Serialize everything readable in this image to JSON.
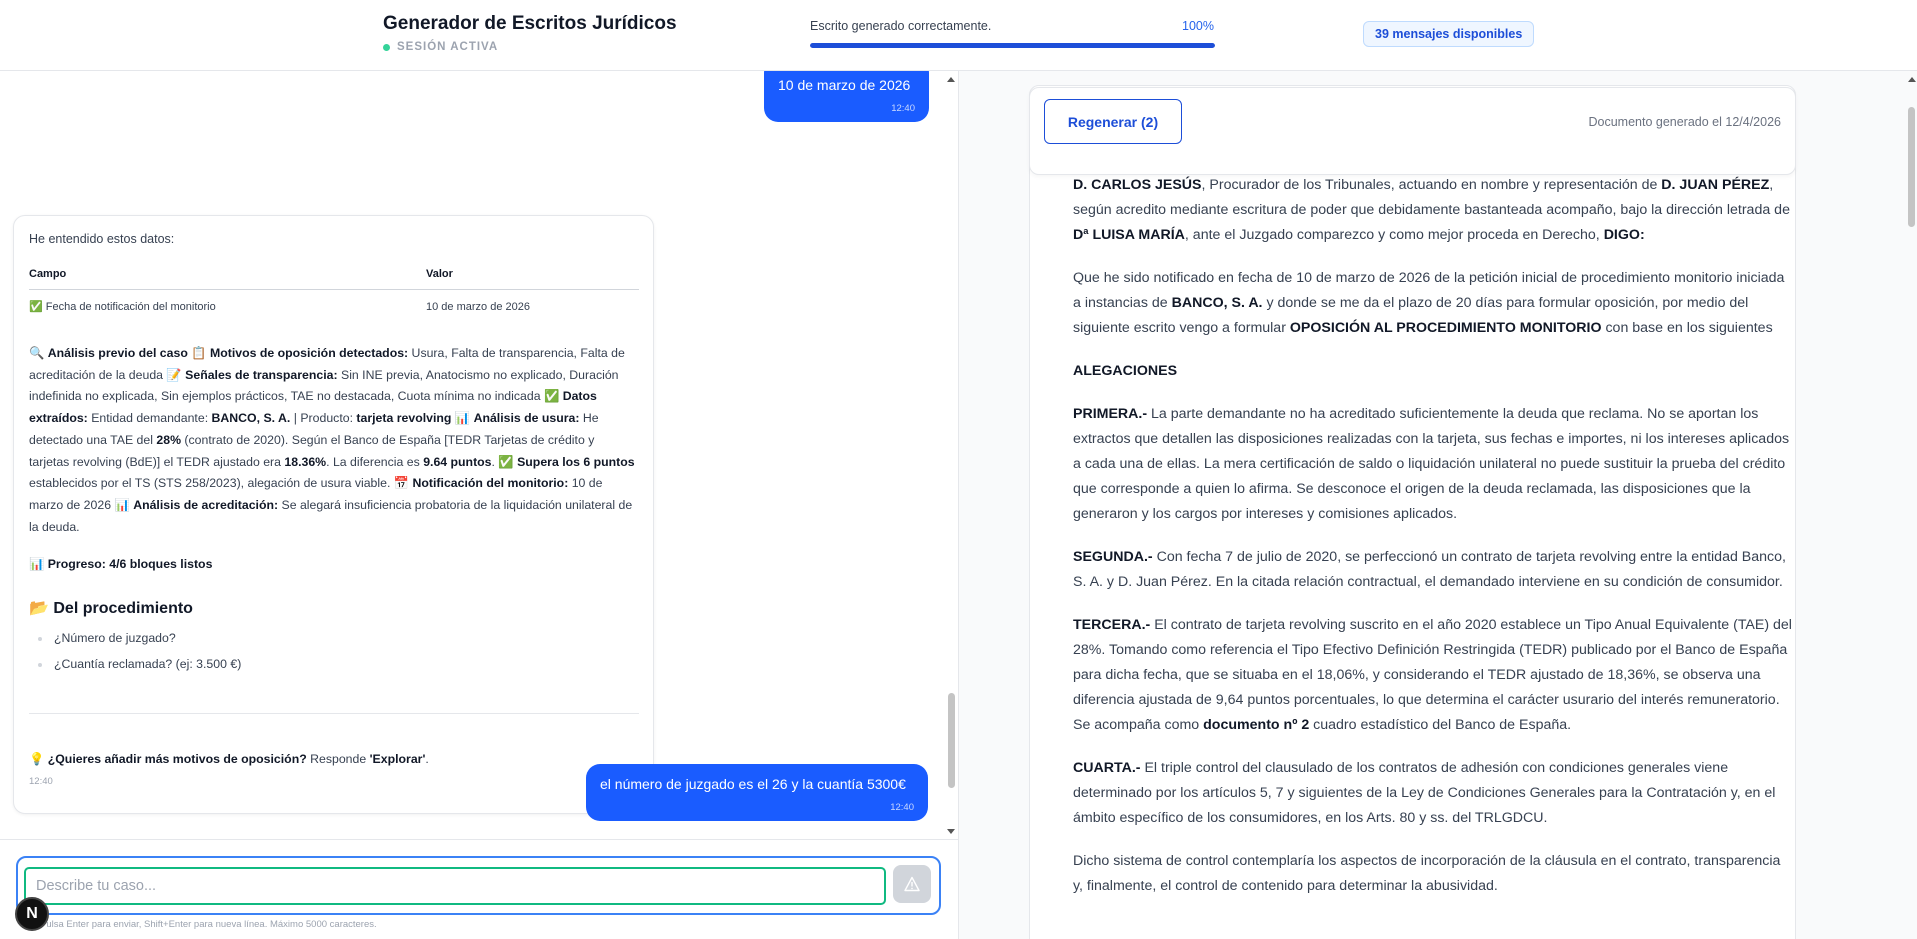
{
  "header": {
    "title": "Generador de Escritos Jurídicos",
    "session_status": "SESIÓN ACTIVA",
    "progress_label": "Escrito generado correctamente.",
    "progress_percent": "100%",
    "progress_value": 1.0,
    "messages_badge": "39 mensajes disponibles"
  },
  "chat": {
    "user_msg_1": {
      "text": "10 de marzo de 2026",
      "time": "12:40"
    },
    "bot": {
      "intro": "He entendido estos datos:",
      "table": {
        "headers": [
          "Campo",
          "Valor"
        ],
        "rows": [
          [
            "✅ Fecha de notificación del monitorio",
            "10 de marzo de 2026"
          ]
        ]
      },
      "analysis": {
        "s1": "🔍 ",
        "b1": "Análisis previo del caso",
        "s2": " 📋 ",
        "b2": "Motivos de oposición detectados:",
        "s3": " Usura, Falta de transparencia, Falta de acreditación de la deuda 📝 ",
        "b3": "Señales de transparencia:",
        "s4": " Sin INE previa, Anatocismo no explicado, Duración indefinida no explicada, Sin ejemplos prácticos, TAE no destacada, Cuota mínima no indicada ✅ ",
        "b4": "Datos extraídos:",
        "s5": " Entidad demandante: ",
        "b5": "BANCO, S. A.",
        "s6": " | Producto: ",
        "b6": "tarjeta revolving",
        "s7": " 📊 ",
        "b7": "Análisis de usura:",
        "s8": " He detectado una TAE del ",
        "b8": "28%",
        "s9": " (contrato de 2020). Según el Banco de España [TEDR Tarjetas de crédito y tarjetas revolving (BdE)] el TEDR ajustado era ",
        "b9": "18.36%",
        "s10": ". La diferencia es ",
        "b10": "9.64 puntos",
        "s11": ". ✅ ",
        "b11": "Supera los 6 puntos",
        "s12": " establecidos por el TS (STS 258/2023), alegación de usura viable. 📅 ",
        "b12": "Notificación del monitorio:",
        "s13": " 10 de marzo de 2026 📊 ",
        "b13": "Análisis de acreditación:",
        "s14": " Se alegará insuficiencia probatoria de la liquidación unilateral de la deuda."
      },
      "progress": "📊 Progreso: 4/6 bloques listos",
      "section_title": "📂 Del procedimiento",
      "questions": [
        "¿Número de juzgado?",
        "¿Cuantía reclamada? (ej: 3.500 €)"
      ],
      "cta_icon": "💡 ",
      "cta_bold": "¿Quieres añadir más motivos de oposición?",
      "cta_text": " Responde ",
      "cta_quote": "'Explorar'",
      "cta_end": ".",
      "time": "12:40"
    },
    "user_msg_2": {
      "text": "el número de juzgado es el 26 y la cuantía 5300€",
      "time": "12:40"
    }
  },
  "input": {
    "placeholder": "Describe tu caso...",
    "hint": "Pulsa Enter para enviar, Shift+Enter para nueva línea. Máximo 5000 caracteres.",
    "send_icon": "warning-triangle-icon",
    "avatar_letter": "N"
  },
  "document": {
    "regenerate_label": "Regenerar (2)",
    "generated_date": "Documento generado el 12/4/2026",
    "p1": {
      "b1": "D. CARLOS JESÚS",
      "t1": ", Procurador de los Tribunales, actuando en nombre y representación de ",
      "b2": "D. JUAN PÉREZ",
      "t2": ", según acredito mediante escritura de poder que debidamente bastanteada acompaño, bajo la dirección letrada de ",
      "b3": "Dª LUISA MARÍA",
      "t3": ", ante el Juzgado comparezco y como mejor proceda en Derecho, ",
      "b4": "DIGO:"
    },
    "p2": {
      "t1": "Que he sido notificado en fecha de 10 de marzo de 2026 de la petición inicial de procedimiento monitorio iniciada a instancias de ",
      "b1": "BANCO, S. A.",
      "t2": " y donde se me da el plazo de 20 días para formular oposición, por medio del siguiente escrito vengo a formular ",
      "b2": "OPOSICIÓN AL PROCEDIMIENTO MONITORIO",
      "t3": " con base en los siguientes"
    },
    "alegaciones": "ALEGACIONES",
    "primera": {
      "h": "PRIMERA.-",
      "t": " La parte demandante no ha acreditado suficientemente la deuda que reclama. No se aportan los extractos que detallen las disposiciones realizadas con la tarjeta, sus fechas e importes, ni los intereses aplicados a cada una de ellas. La mera certificación de saldo o liquidación unilateral no puede sustituir la prueba del crédito que corresponde a quien lo afirma. Se desconoce el origen de la deuda reclamada, las disposiciones que la generaron y los cargos por intereses y comisiones aplicados."
    },
    "segunda": {
      "h": "SEGUNDA.-",
      "t": " Con fecha 7 de julio de 2020, se perfeccionó un contrato de tarjeta revolving entre la entidad Banco, S. A. y D. Juan Pérez. En la citada relación contractual, el demandado interviene en su condición de consumidor."
    },
    "tercera": {
      "h": "TERCERA.-",
      "t": " El contrato de tarjeta revolving suscrito en el año 2020 establece un Tipo Anual Equivalente (TAE) del 28%. Tomando como referencia el Tipo Efectivo Definición Restringida (TEDR) publicado por el Banco de España para dicha fecha, que se situaba en el 18,06%, y considerando el TEDR ajustado de 18,36%, se observa una diferencia ajustada de 9,64 puntos porcentuales, lo que determina el carácter usurario del interés remuneratorio. Se acompaña como ",
      "b": "documento nº 2",
      "t2": " cuadro estadístico del Banco de España."
    },
    "cuarta": {
      "h": "CUARTA.-",
      "t": " El triple control del clausulado de los contratos de adhesión con condiciones generales viene determinado por los artículos 5, 7 y siguientes de la Ley de Condiciones Generales para la Contratación y, en el ámbito específico de los consumidores, en los Arts. 80 y ss. del TRLGDCU."
    },
    "p_last": "Dicho sistema de control contemplaría los aspectos de incorporación de la cláusula en el contrato, transparencia y, finalmente, el control de contenido para determinar la abusividad."
  }
}
